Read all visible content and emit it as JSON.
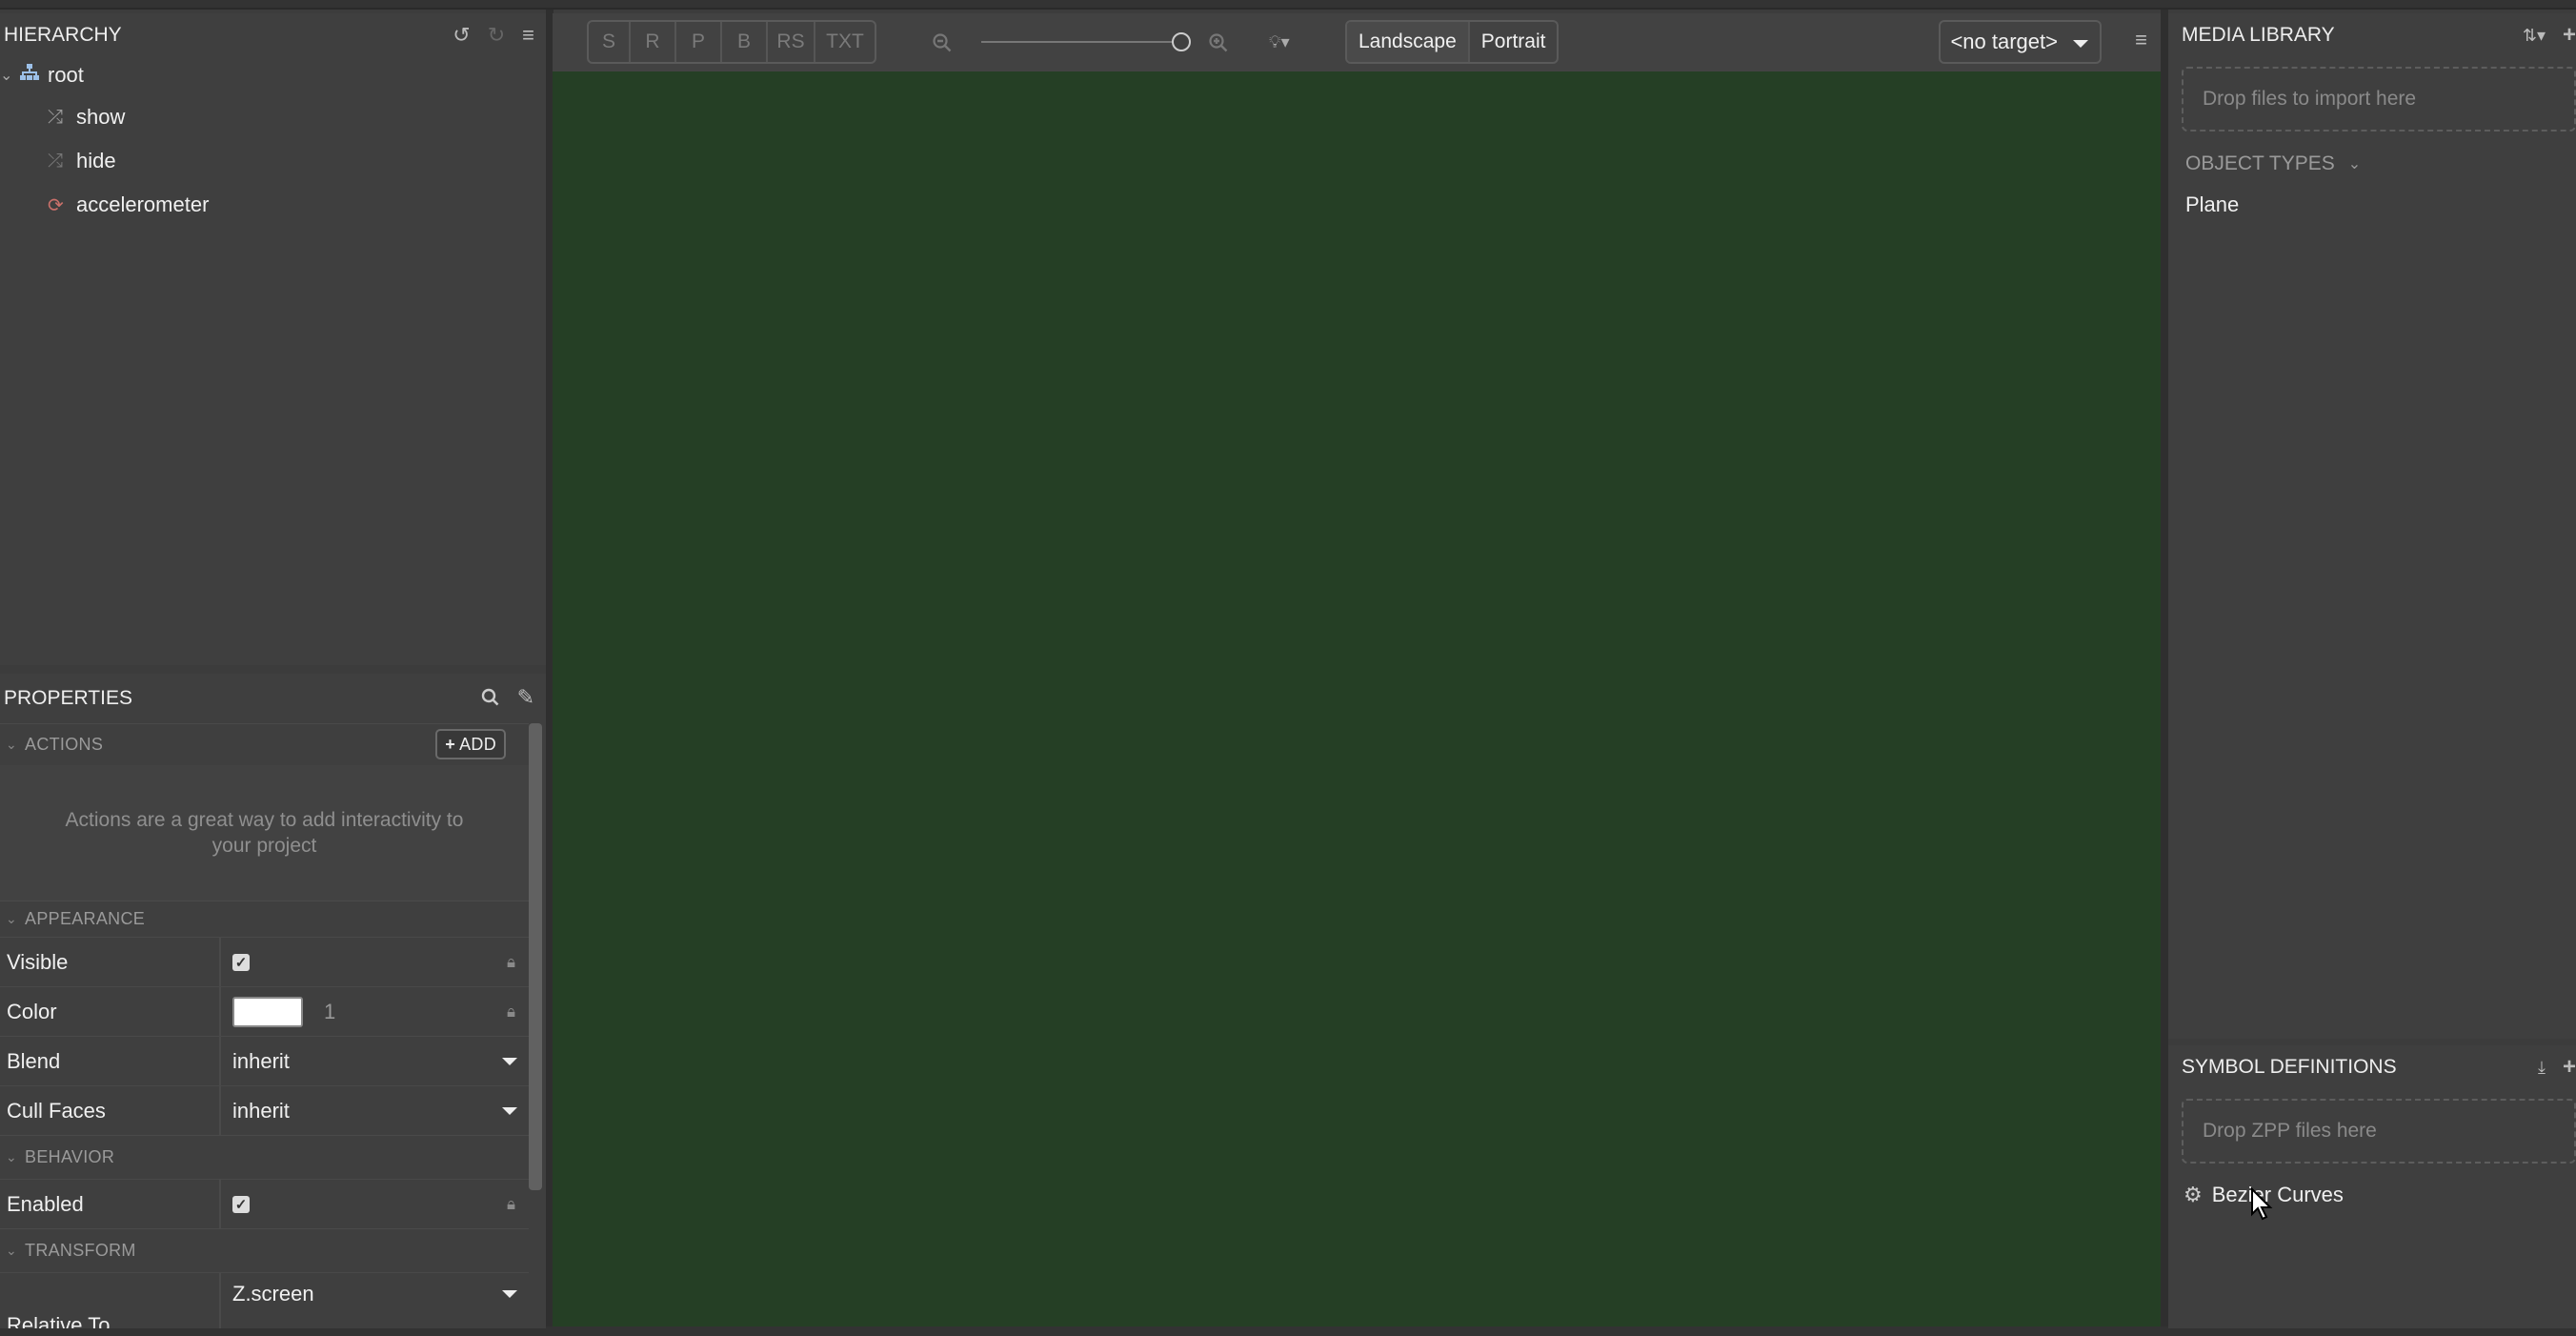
{
  "hierarchy": {
    "title": "HIERARCHY",
    "items": [
      {
        "label": "root",
        "icon": "hierarchy-icon"
      },
      {
        "label": "show",
        "icon": "shuffle-icon"
      },
      {
        "label": "hide",
        "icon": "shuffle-icon"
      },
      {
        "label": "accelerometer",
        "icon": "sync-icon"
      }
    ]
  },
  "properties": {
    "title": "PROPERTIES",
    "actions": {
      "section": "ACTIONS",
      "add_label": "ADD",
      "hint": "Actions are a great way to add interactivity to your project"
    },
    "appearance": {
      "section": "APPEARANCE",
      "visible_label": "Visible",
      "color_label": "Color",
      "color_value": "#ffffff",
      "color_alpha": "1",
      "blend_label": "Blend",
      "blend_value": "inherit",
      "cull_label": "Cull Faces",
      "cull_value": "inherit"
    },
    "behavior": {
      "section": "BEHAVIOR",
      "enabled_label": "Enabled"
    },
    "transform": {
      "section": "TRANSFORM",
      "relative_label": "Relative To",
      "relative_value": "Z.screen"
    }
  },
  "viewport": {
    "tools": [
      "S",
      "R",
      "P",
      "B",
      "RS",
      "TXT"
    ],
    "orientation": [
      "Landscape",
      "Portrait"
    ],
    "active_orientation": "Landscape",
    "target": "<no target>",
    "canvas_color": "#253f25"
  },
  "media": {
    "title": "MEDIA LIBRARY",
    "drop_hint": "Drop files to import here",
    "object_types_label": "OBJECT TYPES",
    "object_types": [
      "Plane"
    ]
  },
  "symbols": {
    "title": "SYMBOL DEFINITIONS",
    "drop_hint": "Drop ZPP files here",
    "items": [
      "Bezier Curves"
    ]
  }
}
